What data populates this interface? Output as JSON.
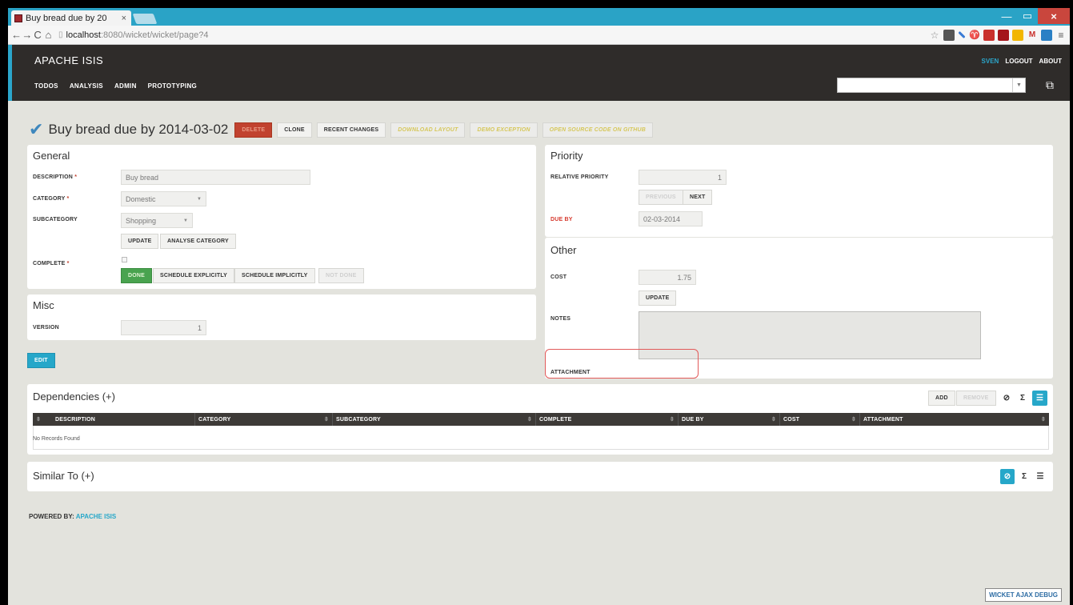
{
  "browser": {
    "tab_title": "Buy bread due by 20",
    "tab_close": "×",
    "url_host": "localhost",
    "url_rest": ":8080/wicket/wicket/page?4",
    "min": "—",
    "max": "▭",
    "close": "×"
  },
  "app": {
    "name": "APACHE ISIS",
    "menus": [
      "TODOS",
      "ANALYSIS",
      "ADMIN",
      "PROTOTYPING"
    ],
    "user": "SVEN",
    "logout": "LOGOUT",
    "about": "ABOUT"
  },
  "entity": {
    "title": "Buy bread due by 2014-03-02",
    "actions": {
      "delete": "DELETE",
      "clone": "CLONE",
      "recent": "RECENT CHANGES",
      "download": "DOWNLOAD LAYOUT",
      "demo": "DEMO EXCEPTION",
      "source": "OPEN SOURCE CODE ON GITHUB"
    }
  },
  "general": {
    "title": "General",
    "description_label": "DESCRIPTION",
    "description_value": "Buy bread",
    "category_label": "CATEGORY",
    "category_value": "Domestic",
    "subcategory_label": "SUBCATEGORY",
    "subcategory_value": "Shopping",
    "update": "UPDATE",
    "analyse": "ANALYSE CATEGORY",
    "complete_label": "COMPLETE",
    "done": "DONE",
    "schedule_explicitly": "SCHEDULE EXPLICITLY",
    "schedule_implicitly": "SCHEDULE IMPLICITLY",
    "not_done": "NOT DONE",
    "required": "*"
  },
  "misc": {
    "title": "Misc",
    "version_label": "VERSION",
    "version_value": "1",
    "edit": "EDIT"
  },
  "priority": {
    "title": "Priority",
    "relative_label": "RELATIVE PRIORITY",
    "relative_value": "1",
    "previous": "PREVIOUS",
    "next": "NEXT",
    "due_label": "DUE BY",
    "due_value": "02-03-2014"
  },
  "other": {
    "title": "Other",
    "cost_label": "COST",
    "cost_value": "1.75",
    "update": "UPDATE",
    "notes_label": "NOTES",
    "attachment_label": "ATTACHMENT"
  },
  "dependencies": {
    "title": "Dependencies (+)",
    "add": "ADD",
    "remove": "REMOVE",
    "columns": [
      "DESCRIPTION",
      "CATEGORY",
      "SUBCATEGORY",
      "COMPLETE",
      "DUE BY",
      "COST",
      "ATTACHMENT"
    ],
    "empty": "No Records Found"
  },
  "similar": {
    "title": "Similar To (+)"
  },
  "footer": {
    "powered_by": "POWERED BY:",
    "powered_link": "APACHE ISIS",
    "debug": "WICKET AJAX DEBUG"
  },
  "icons": {
    "hide": "⊘",
    "sum": "Σ",
    "list": "☰"
  }
}
